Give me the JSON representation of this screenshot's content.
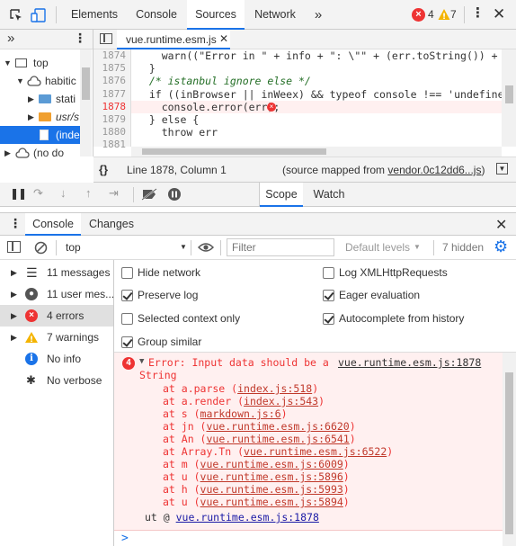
{
  "top_tabs": [
    "Elements",
    "Console",
    "Sources",
    "Network"
  ],
  "top_tabs_active": "Sources",
  "badges": {
    "errors": "4",
    "warnings": "7"
  },
  "navigator": {
    "items": [
      {
        "label": "top"
      },
      {
        "label": "habitic"
      },
      {
        "label": "stati"
      },
      {
        "label": "usr/s"
      },
      {
        "label": "(inde"
      },
      {
        "label": "(no do"
      }
    ]
  },
  "editor": {
    "file_tab": "vue.runtime.esm.js",
    "line_numbers": [
      "1874",
      "1875",
      "1876",
      "1877",
      "1878",
      "1879",
      "1880",
      "1881"
    ],
    "current_line": "1878",
    "code": {
      "l1874_a": "    warn((\"Error in \" + info + \": \\\"\" + (err.toString()) + \"\\\"\"",
      "l1875": "  }",
      "l1876": "  /* istanbul ignore else */",
      "l1877_a": "  if ((inBrowser || inWeex) && typeof console !== 'undefined')",
      "l1878": "    console.error(err);",
      "l1879": "  } else {",
      "l1880": "    throw err"
    }
  },
  "status": {
    "position": "Line 1878, Column 1",
    "source_mapped_prefix": "(source mapped from ",
    "source_mapped_link": "vendor.0c12dd6...js",
    "source_mapped_suffix": ")"
  },
  "debugger_tabs": [
    "Scope",
    "Watch"
  ],
  "drawer_tabs": [
    "Console",
    "Changes"
  ],
  "console_toolbar": {
    "context": "top",
    "filter_placeholder": "Filter",
    "levels": "Default levels",
    "hidden": "7 hidden"
  },
  "sidebar": [
    {
      "label": "11 messages"
    },
    {
      "label": "11 user mes..."
    },
    {
      "label": "4 errors"
    },
    {
      "label": "7 warnings"
    },
    {
      "label": "No info"
    },
    {
      "label": "No verbose"
    }
  ],
  "settings": {
    "hide_network": {
      "label": "Hide network",
      "checked": false
    },
    "preserve_log": {
      "label": "Preserve log",
      "checked": true
    },
    "selected_context": {
      "label": "Selected context only",
      "checked": false
    },
    "group_similar": {
      "label": "Group similar",
      "checked": true
    },
    "log_xhr": {
      "label": "Log XMLHttpRequests",
      "checked": false
    },
    "eager_eval": {
      "label": "Eager evaluation",
      "checked": true
    },
    "autocomplete": {
      "label": "Autocomplete from history",
      "checked": true
    }
  },
  "error": {
    "count": "4",
    "message_line1": "Error: Input data should be a",
    "message_line2": "String",
    "source_link": "vue.runtime.esm.js:1878",
    "stack": [
      {
        "fn": "at a.parse (",
        "loc": "index.js:518",
        "end": ")"
      },
      {
        "fn": "at a.render (",
        "loc": "index.js:543",
        "end": ")"
      },
      {
        "fn": "at s (",
        "loc": "markdown.js:6",
        "end": ")"
      },
      {
        "fn": "at jn (",
        "loc": "vue.runtime.esm.js:6620",
        "end": ")"
      },
      {
        "fn": "at An (",
        "loc": "vue.runtime.esm.js:6541",
        "end": ")"
      },
      {
        "fn": "at Array.Tn (",
        "loc": "vue.runtime.esm.js:6522",
        "end": ")"
      },
      {
        "fn": "at m (",
        "loc": "vue.runtime.esm.js:6009",
        "end": ")"
      },
      {
        "fn": "at u (",
        "loc": "vue.runtime.esm.js:5896",
        "end": ")"
      },
      {
        "fn": "at h (",
        "loc": "vue.runtime.esm.js:5993",
        "end": ")"
      },
      {
        "fn": "at u (",
        "loc": "vue.runtime.esm.js:5894",
        "end": ")"
      }
    ],
    "ut_prefix": "ut @ ",
    "ut_link": "vue.runtime.esm.js:1878"
  },
  "prompt": ">",
  "colors": {
    "accent": "#1a73e8",
    "error": "#e33",
    "error_bg": "#fff0f0"
  }
}
